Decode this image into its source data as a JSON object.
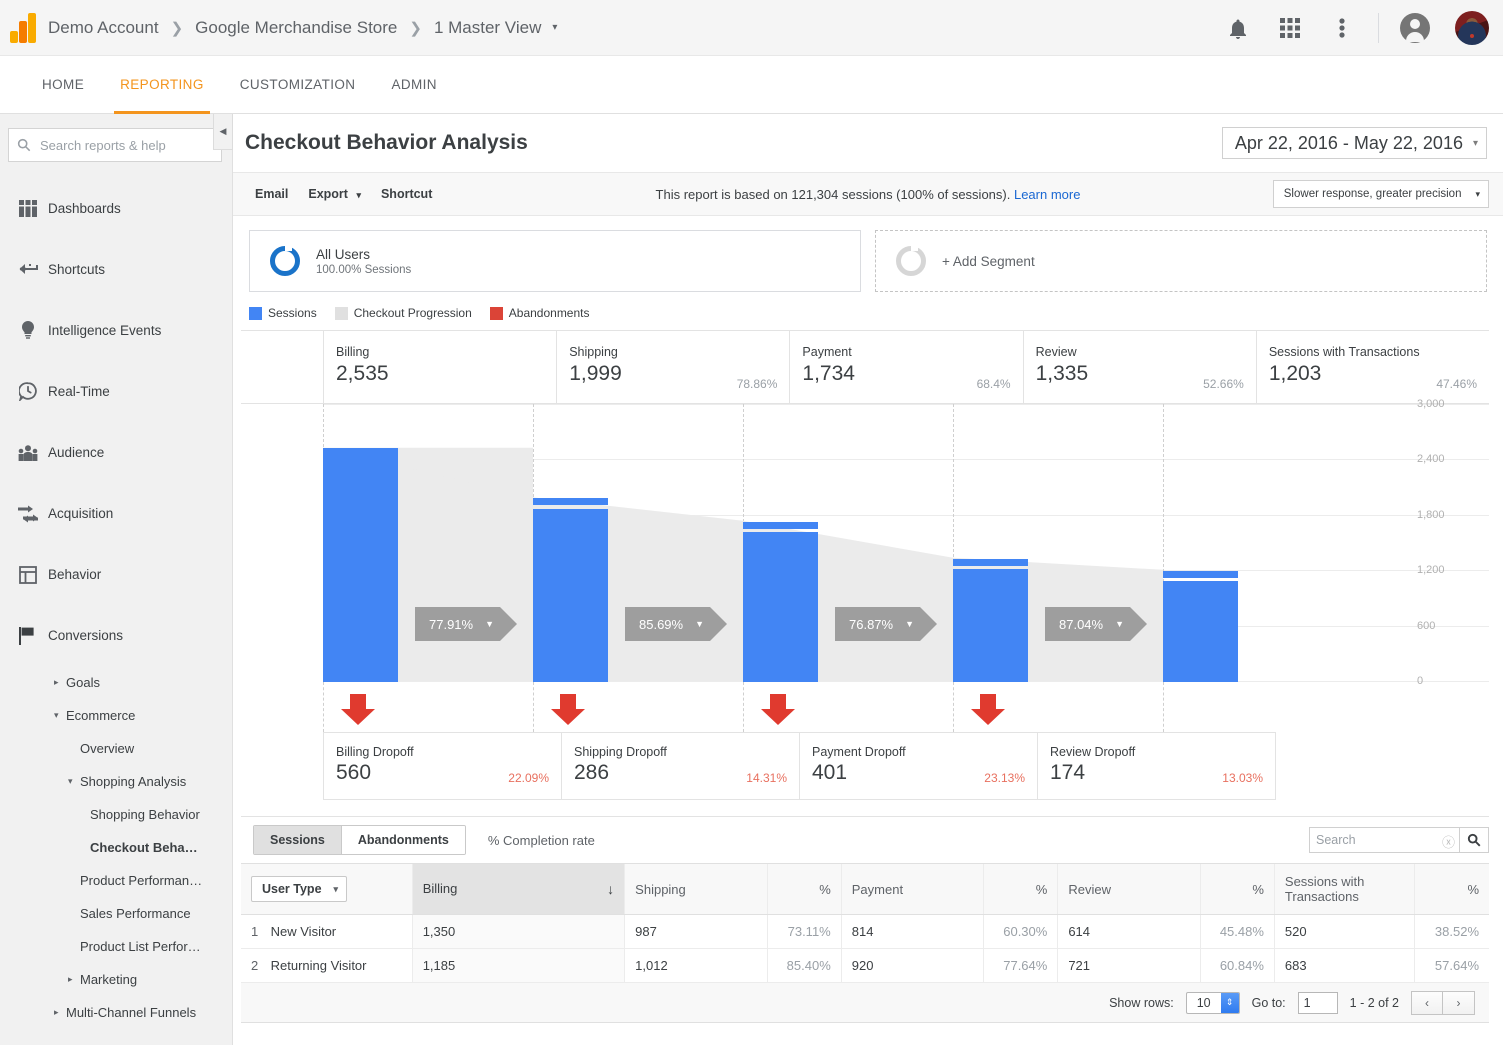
{
  "topbar": {
    "logo_icon": "google-analytics-logo",
    "breadcrumb": [
      "Demo Account",
      "Google Merchandise Store",
      "1 Master View"
    ],
    "breadcrumb_caret": "▾",
    "icons": [
      "notifications-bell-icon",
      "apps-grid-icon",
      "more-vert-icon",
      "account-circle-icon",
      "user-avatar"
    ]
  },
  "nav_tabs": [
    {
      "label": "HOME",
      "active": false
    },
    {
      "label": "REPORTING",
      "active": true
    },
    {
      "label": "CUSTOMIZATION",
      "active": false
    },
    {
      "label": "ADMIN",
      "active": false
    }
  ],
  "sidebar": {
    "search_placeholder": "Search reports & help",
    "search_value": "",
    "search_icon": "search-icon",
    "collapse_icon": "◀",
    "items": [
      {
        "label": "Dashboards",
        "icon": "dashboards-icon"
      },
      {
        "label": "Shortcuts",
        "icon": "shortcuts-arrow-icon"
      },
      {
        "label": "Intelligence Events",
        "icon": "lightbulb-icon"
      },
      {
        "label": "Real-Time",
        "icon": "clock-bubble-icon"
      },
      {
        "label": "Audience",
        "icon": "people-icon"
      },
      {
        "label": "Acquisition",
        "icon": "arrows-icon"
      },
      {
        "label": "Behavior",
        "icon": "layout-icon"
      },
      {
        "label": "Conversions",
        "icon": "flag-icon"
      }
    ],
    "sub_items": [
      {
        "label": "Goals",
        "indent": 1,
        "tri": "▸",
        "selected": false
      },
      {
        "label": "Ecommerce",
        "indent": 1,
        "tri": "▾",
        "selected": false
      },
      {
        "label": "Overview",
        "indent": 2,
        "tri": "",
        "selected": false
      },
      {
        "label": "Shopping Analysis",
        "indent": 2,
        "tri": "▾",
        "selected": false
      },
      {
        "label": "Shopping Behavior",
        "indent": 3,
        "tri": "",
        "selected": false
      },
      {
        "label": "Checkout Beha…",
        "indent": 3,
        "tri": "",
        "selected": true
      },
      {
        "label": "Product Performan…",
        "indent": 2,
        "tri": "",
        "selected": false
      },
      {
        "label": "Sales Performance",
        "indent": 2,
        "tri": "",
        "selected": false
      },
      {
        "label": "Product List Perfor…",
        "indent": 2,
        "tri": "",
        "selected": false
      },
      {
        "label": "Marketing",
        "indent": 2,
        "tri": "▸",
        "selected": false
      },
      {
        "label": "Multi-Channel Funnels",
        "indent": 1,
        "tri": "▸",
        "selected": false
      }
    ]
  },
  "report": {
    "title": "Checkout Behavior Analysis",
    "date_range": "Apr 22, 2016 - May 22, 2016",
    "date_caret": "▾",
    "toolbar": {
      "email": "Email",
      "export": "Export",
      "export_caret": "▾",
      "shortcut": "Shortcut",
      "sampling_note": "This report is based on 121,304 sessions (100% of sessions).",
      "learn_more": "Learn more",
      "precision": "Slower response, greater precision",
      "precision_caret": "▾"
    },
    "segments": {
      "all_users_title": "All Users",
      "all_users_sub": "100.00% Sessions",
      "add_segment": "+ Add Segment"
    },
    "legend": [
      {
        "label": "Sessions",
        "color": "#4285f4"
      },
      {
        "label": "Checkout Progression",
        "color": "#e0e0e0"
      },
      {
        "label": "Abandonments",
        "color": "#db4437"
      }
    ]
  },
  "chart_data": {
    "type": "bar",
    "title": "Checkout Behavior Analysis",
    "ylabel": "",
    "xlabel": "",
    "ylim": [
      0,
      3000
    ],
    "yticks": [
      "0",
      "600",
      "1,200",
      "1,800",
      "2,400",
      "3,000"
    ],
    "grid": true,
    "legend_position": "top-left",
    "categories": [
      "Billing",
      "Shipping",
      "Payment",
      "Review",
      "Sessions with Transactions"
    ],
    "values": [
      2535,
      1999,
      1734,
      1335,
      1203
    ],
    "value_labels": [
      "2,535",
      "1,999",
      "1,734",
      "1,335",
      "1,203"
    ],
    "pct_of_first": [
      "",
      "78.86%",
      "68.4%",
      "52.66%",
      "47.46%"
    ],
    "progression_rates": [
      "77.91%",
      "85.69%",
      "76.87%",
      "87.04%"
    ],
    "dropoffs": [
      {
        "label": "Billing Dropoff",
        "value": "560",
        "pct": "22.09%"
      },
      {
        "label": "Shipping Dropoff",
        "value": "286",
        "pct": "14.31%"
      },
      {
        "label": "Payment Dropoff",
        "value": "401",
        "pct": "23.13%"
      },
      {
        "label": "Review Dropoff",
        "value": "174",
        "pct": "13.03%"
      }
    ]
  },
  "table": {
    "toggle_sessions": "Sessions",
    "toggle_abandonments": "Abandonments",
    "completion_rate": "% Completion rate",
    "search_placeholder": "Search",
    "search_value": "",
    "search_icon": "search-icon",
    "clear_icon": "clear-icon",
    "dimension_button": "User Type",
    "dimension_caret": "▾",
    "sort_icon": "↓",
    "columns": [
      "Billing",
      "Shipping",
      "%",
      "Payment",
      "%",
      "Review",
      "%",
      "Sessions with Transactions",
      "%"
    ],
    "rows": [
      {
        "idx": "1",
        "user_type": "New Visitor",
        "billing": "1,350",
        "shipping": "987",
        "shipping_pct": "73.11%",
        "payment": "814",
        "payment_pct": "60.30%",
        "review": "614",
        "review_pct": "45.48%",
        "transactions": "520",
        "transactions_pct": "38.52%"
      },
      {
        "idx": "2",
        "user_type": "Returning Visitor",
        "billing": "1,185",
        "shipping": "1,012",
        "shipping_pct": "85.40%",
        "payment": "920",
        "payment_pct": "77.64%",
        "review": "721",
        "review_pct": "60.84%",
        "transactions": "683",
        "transactions_pct": "57.64%"
      }
    ],
    "footer": {
      "show_rows_label": "Show rows:",
      "show_rows_value": "10",
      "goto_label": "Go to:",
      "goto_value": "1",
      "range": "1 - 2 of 2",
      "prev_icon": "‹",
      "next_icon": "›"
    }
  },
  "colors": {
    "accent_orange": "#f3941d",
    "sessions_blue": "#4285f4",
    "progression_gray": "#e0e0e0",
    "abandonment_red": "#db4437",
    "dropoff_red_text": "#e8705f",
    "link_blue": "#1967d2"
  }
}
